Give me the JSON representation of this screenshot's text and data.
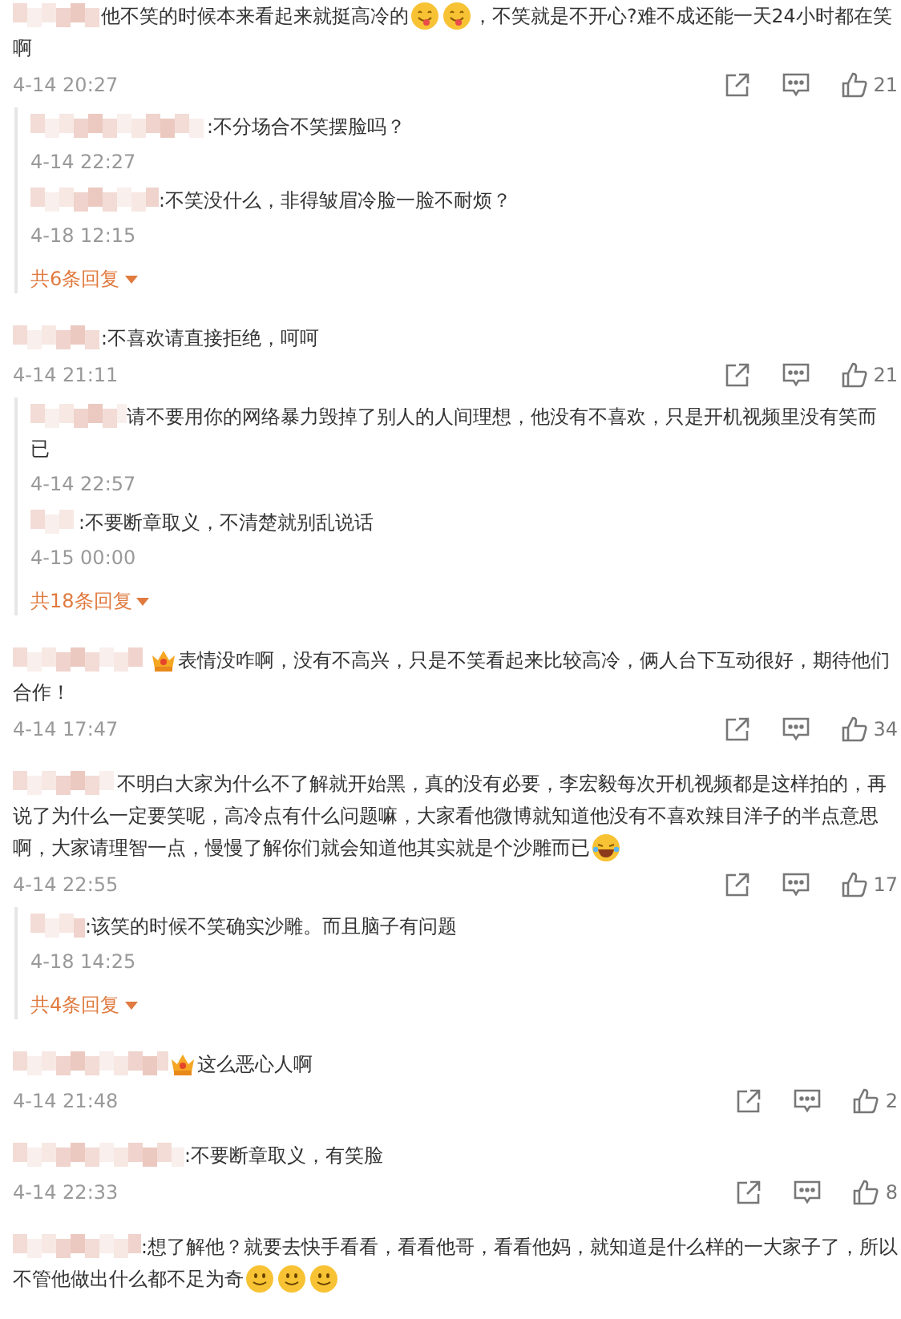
{
  "comments": [
    {
      "lines": [
        [
          {
            "kind": "text",
            "text": "他不笑的时候本来看起来就挺高冷的"
          },
          {
            "kind": "yum"
          },
          {
            "kind": "yum"
          },
          {
            "kind": "text",
            "text": "，不笑就是不开心?难不成还能一天24小时都在笑"
          }
        ],
        [
          {
            "kind": "text",
            "text": "啊"
          }
        ]
      ],
      "date": "4-14 20:27",
      "likes": "21",
      "replies": [
        {
          "lines": [
            [
              {
                "kind": "text",
                "text": ":不分场合不笑摆脸吗？"
              }
            ]
          ],
          "date": "4-14 22:27"
        },
        {
          "lines": [
            [
              {
                "kind": "text",
                "text": ":不笑没什么，非得皱眉冷脸一脸不耐烦？"
              }
            ]
          ],
          "date": "4-18 12:15"
        }
      ],
      "more_replies": "共6条回复"
    },
    {
      "lines": [
        [
          {
            "kind": "text",
            "text": ":不喜欢请直接拒绝，呵呵"
          }
        ]
      ],
      "date": "4-14 21:11",
      "likes": "21",
      "replies": [
        {
          "lines": [
            [
              {
                "kind": "text",
                "text": "请不要用你的网络暴力毁掉了别人的人间理想，他没有不喜欢，只是开机视频里没有笑而"
              }
            ],
            [
              {
                "kind": "text",
                "text": "已"
              }
            ]
          ],
          "date": "4-14 22:57"
        },
        {
          "lines": [
            [
              {
                "kind": "text",
                "text": ":不要断章取义，不清楚就别乱说话"
              }
            ]
          ],
          "date": "4-15 00:00"
        }
      ],
      "more_replies": "共18条回复"
    },
    {
      "lines": [
        [
          {
            "kind": "crown"
          },
          {
            "kind": "text",
            "text": "表情没咋啊，没有不高兴，只是不笑看起来比较高冷，俩人台下互动很好，期待他们"
          }
        ],
        [
          {
            "kind": "text",
            "text": "合作！"
          }
        ]
      ],
      "date": "4-14 17:47",
      "likes": "34"
    },
    {
      "lines": [
        [
          {
            "kind": "text",
            "text": "不明白大家为什么不了解就开始黑，真的没有必要，李宏毅每次开机视频都是这样拍的，再"
          }
        ],
        [
          {
            "kind": "text",
            "text": "说了为什么一定要笑呢，高冷点有什么问题嘛，大家看他微博就知道他没有不喜欢辣目洋子的半点意思"
          }
        ],
        [
          {
            "kind": "text",
            "text": "啊，大家请理智一点，慢慢了解你们就会知道他其实就是个沙雕而已"
          },
          {
            "kind": "laugh"
          }
        ]
      ],
      "date": "4-14 22:55",
      "likes": "17",
      "replies": [
        {
          "lines": [
            [
              {
                "kind": "text",
                "text": ":该笑的时候不笑确实沙雕。而且脑子有问题"
              }
            ]
          ],
          "date": "4-18 14:25"
        }
      ],
      "more_replies": "共4条回复"
    },
    {
      "lines": [
        [
          {
            "kind": "crown"
          },
          {
            "kind": "text",
            "text": "这么恶心人啊"
          }
        ]
      ],
      "date": "4-14 21:48",
      "likes": "2"
    },
    {
      "lines": [
        [
          {
            "kind": "text",
            "text": ":不要断章取义，有笑脸"
          }
        ]
      ],
      "date": "4-14 22:33",
      "likes": "8"
    },
    {
      "lines": [
        [
          {
            "kind": "text",
            "text": ":想了解他？就要去快手看看，看看他哥，看看他妈，就知道是什么样的一大家子了，所以"
          }
        ],
        [
          {
            "kind": "text",
            "text": "不管他做出什么都不足为奇"
          },
          {
            "kind": "smile"
          },
          {
            "kind": "smile"
          },
          {
            "kind": "smile"
          }
        ]
      ]
    }
  ]
}
